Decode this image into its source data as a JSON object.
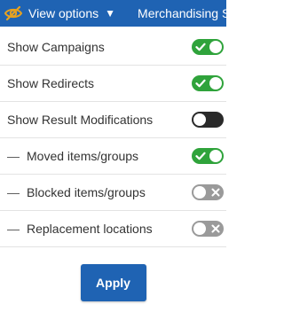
{
  "colors": {
    "brand": "#1f63b3",
    "toggle_on": "#2fa33b",
    "toggle_off": "#9a9a9a",
    "toggle_partial": "#2a2a2a"
  },
  "topbar": {
    "eye_icon": "eye-slash-icon",
    "view_options_label": "View options",
    "view_options_caret": "▼",
    "merchandising_label": "Merchandising S"
  },
  "options": [
    {
      "label": "Show Campaigns",
      "indent": false,
      "state": "on"
    },
    {
      "label": "Show Redirects",
      "indent": false,
      "state": "on"
    },
    {
      "label": "Show Result Modifications",
      "indent": false,
      "state": "partial"
    },
    {
      "label": "Moved items/groups",
      "indent": true,
      "state": "on"
    },
    {
      "label": "Blocked items/groups",
      "indent": true,
      "state": "off"
    },
    {
      "label": "Replacement locations",
      "indent": true,
      "state": "off"
    }
  ],
  "dash_glyph": "—",
  "apply_label": "Apply"
}
